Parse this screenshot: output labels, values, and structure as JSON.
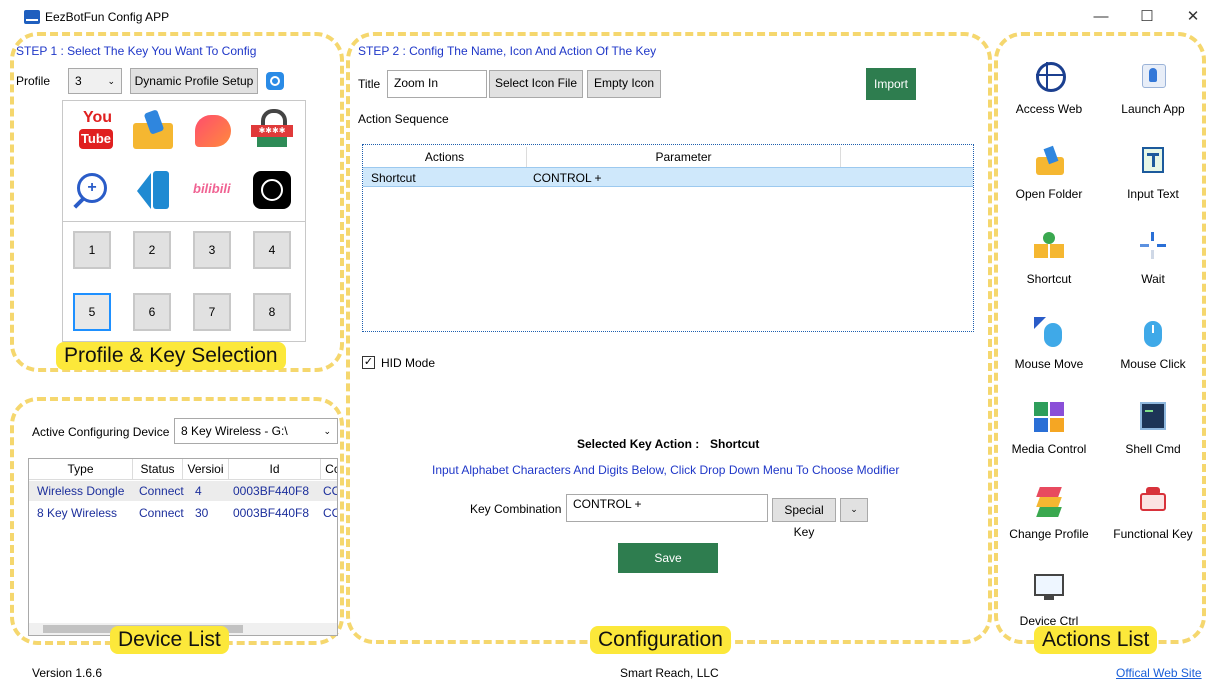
{
  "app": {
    "title": "EezBotFun Config APP",
    "min": "—",
    "max": "☐",
    "close": "✕"
  },
  "step1": {
    "title": "STEP 1 : Select The Key You Want To Config",
    "profile_label": "Profile",
    "profile_value": "3",
    "dynamic_btn": "Dynamic Profile Setup",
    "icons": [
      "youtube",
      "open-folder",
      "heart",
      "password-lock",
      "zoom-in",
      "vscode",
      "bilibili",
      "chatgpt"
    ],
    "youtube_you": "You",
    "youtube_tube": "Tube",
    "bilibili_text": "bilibili",
    "password_text": "✱✱✱✱",
    "keys": [
      "1",
      "2",
      "3",
      "4",
      "5",
      "6",
      "7",
      "8"
    ],
    "selected_key": "5"
  },
  "device": {
    "active_label": "Active Configuring Device",
    "active_value": "8 Key Wireless - G:\\",
    "columns": [
      "Type",
      "Status",
      "Versioi",
      "Id",
      "Cc"
    ],
    "rows": [
      {
        "type": "Wireless Dongle",
        "status": "Connect",
        "version": "4",
        "id": "0003BF440F8",
        "c": "CO"
      },
      {
        "type": "8 Key Wireless",
        "status": "Connect",
        "version": "30",
        "id": "0003BF440F8",
        "c": "CO"
      }
    ]
  },
  "step2": {
    "title": "STEP 2 : Config The Name, Icon And Action Of The Key",
    "title_label": "Title",
    "title_value": "Zoom In",
    "select_icon_btn": "Select Icon File",
    "empty_icon_btn": "Empty Icon",
    "import_btn": "Import",
    "action_seq_label": "Action Sequence",
    "columns": [
      "Actions",
      "Parameter"
    ],
    "rows": [
      {
        "action": "Shortcut",
        "parameter": "CONTROL +"
      }
    ],
    "hid_label": "HID Mode",
    "hid_checked": true,
    "selected_action_label": "Selected Key Action :",
    "selected_action_value": "Shortcut",
    "hint": "Input Alphabet Characters And Digits Below, Click Drop Down Menu To Choose Modifier",
    "key_combo_label": "Key Combination",
    "key_combo_value": "CONTROL +",
    "special_key_btn": "Special Key",
    "save_btn": "Save"
  },
  "actions": [
    {
      "label": "Access Web",
      "icon": "globe-icon"
    },
    {
      "label": "Launch App",
      "icon": "rocket-icon"
    },
    {
      "label": "Open Folder",
      "icon": "folder-icon"
    },
    {
      "label": "Input Text",
      "icon": "text-input-icon"
    },
    {
      "label": "Shortcut",
      "icon": "shortcut-keys-icon"
    },
    {
      "label": "Wait",
      "icon": "spinner-icon"
    },
    {
      "label": "Mouse Move",
      "icon": "mouse-move-icon"
    },
    {
      "label": "Mouse Click",
      "icon": "mouse-click-icon"
    },
    {
      "label": "Media Control",
      "icon": "media-icon"
    },
    {
      "label": "Shell Cmd",
      "icon": "terminal-icon"
    },
    {
      "label": "Change Profile",
      "icon": "layers-icon"
    },
    {
      "label": "Functional Key",
      "icon": "keyboard-icon"
    },
    {
      "label": "Device Ctrl",
      "icon": "device-icon"
    }
  ],
  "regions": {
    "profile": "Profile & Key Selection",
    "device": "Device List",
    "config": "Configuration",
    "actions": "Actions List"
  },
  "footer": {
    "version": "Version 1.6.6",
    "company": "Smart Reach, LLC",
    "website": "Offical Web Site"
  },
  "colors": {
    "accent_blue": "#1f37c8",
    "import_green": "#2e7d4f",
    "save_green": "#2e7d4f",
    "highlight_row": "#cfe8fb",
    "region_yellow": "#f5d76e"
  }
}
